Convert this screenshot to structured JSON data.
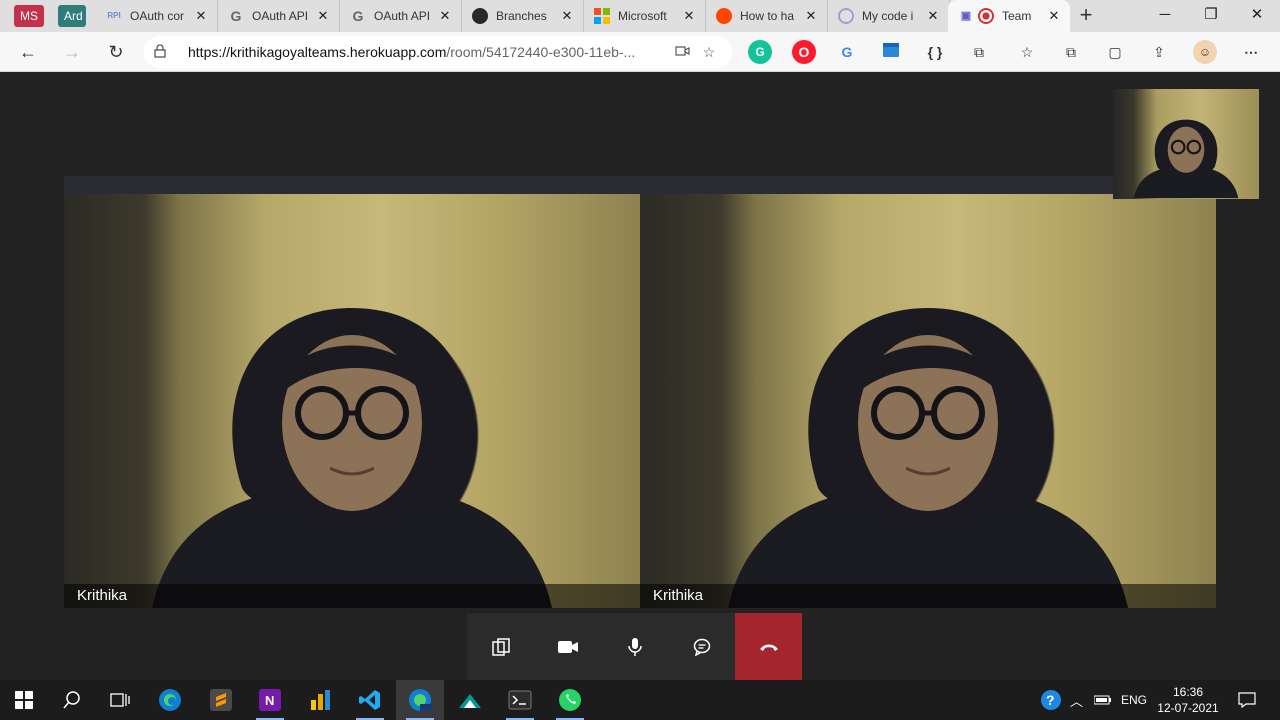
{
  "browser": {
    "workspaces": [
      "MS",
      "Ard"
    ],
    "tabs": [
      {
        "label": "OAuth cor",
        "favicon": "rpi-icon",
        "color": "#6a8fd6"
      },
      {
        "label": "OAuth API",
        "favicon": "google-icon",
        "color": "#4285f4"
      },
      {
        "label": "OAuth API",
        "favicon": "google-icon",
        "color": "#4285f4"
      },
      {
        "label": "Branches",
        "favicon": "github-icon",
        "color": "#24292e"
      },
      {
        "label": "Microsoft",
        "favicon": "microsoft-icon",
        "color": "#f25022"
      },
      {
        "label": "How to ha",
        "favicon": "reddit-icon",
        "color": "#ff4500"
      },
      {
        "label": "My code i",
        "favicon": "loading-icon",
        "color": "#a0a0c8"
      },
      {
        "label": "Team",
        "favicon": "record-icon",
        "color": "#d13438",
        "active": true
      }
    ],
    "new_tab_label": "+",
    "window_controls": {
      "minimize": "─",
      "restore": "❐",
      "close": "✕"
    },
    "url_host": "https://krithikagoyalteams.herokuapp.com",
    "url_path": "/room/54172440-e300-11eb-...",
    "extensions": [
      "grammarly-icon",
      "opera-icon",
      "translate-icon",
      "screenshot-icon",
      "json-icon",
      "puzzle-icon",
      "favorites-icon",
      "collections-icon",
      "webcapture-icon",
      "share-icon",
      "profile-avatar-icon",
      "more-icon"
    ]
  },
  "call": {
    "participants": [
      {
        "name": "Krithika"
      },
      {
        "name": "Krithika"
      }
    ],
    "controls": [
      "share-screen",
      "camera",
      "microphone",
      "chat",
      "hang-up"
    ],
    "end_color": "#a4262c"
  },
  "taskbar": {
    "apps": [
      "start",
      "search",
      "task-view",
      "edge",
      "sublime",
      "onenote",
      "power-bi",
      "vscode",
      "edge-beta",
      "arduino",
      "terminal",
      "whatsapp"
    ],
    "tray": {
      "language": "ENG",
      "time": "16:36",
      "date": "12-07-2021"
    }
  }
}
